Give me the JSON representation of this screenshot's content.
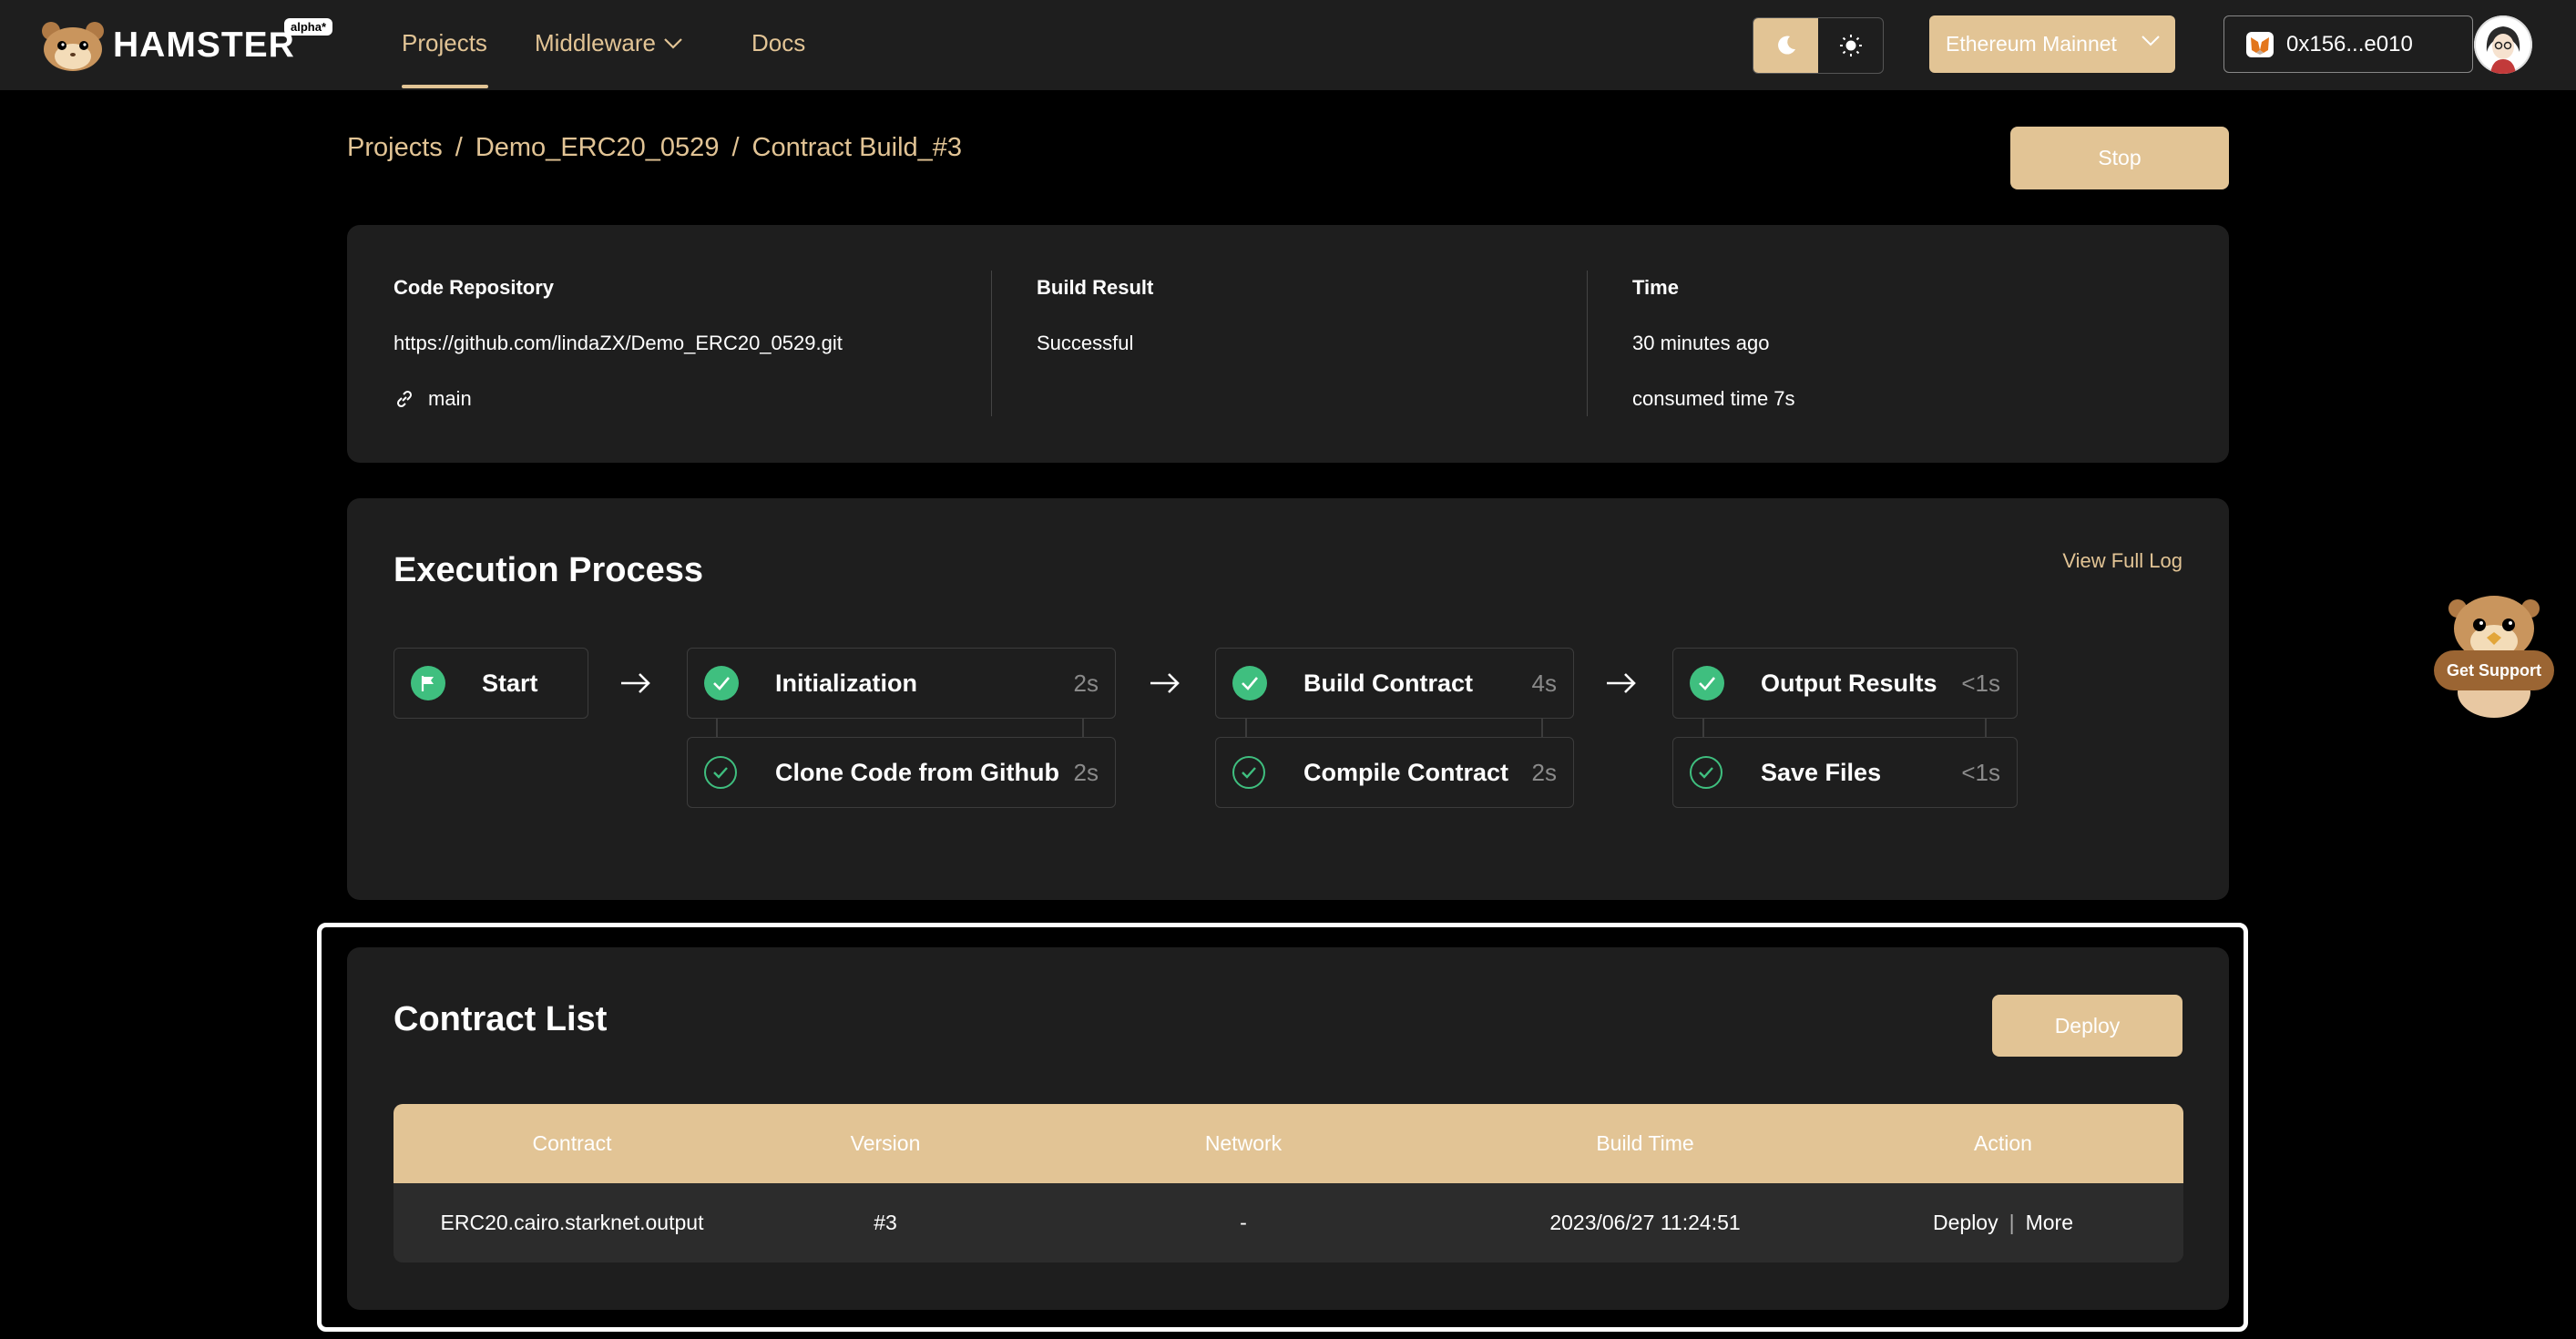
{
  "app": {
    "brand": "HAMSTER",
    "badge": "alpha*"
  },
  "nav": {
    "projects": "Projects",
    "middleware": "Middleware",
    "docs": "Docs"
  },
  "header": {
    "network": "Ethereum Mainnet",
    "wallet": "0x156...e010"
  },
  "breadcrumb": [
    "Projects",
    "Demo_ERC20_0529",
    "Contract Build_#3"
  ],
  "breadcrumb_sep": "/",
  "actions": {
    "stop": "Stop"
  },
  "info": {
    "repo_label": "Code Repository",
    "repo_url": "https://github.com/lindaZX/Demo_ERC20_0529.git",
    "branch": "main",
    "result_label": "Build Result",
    "result_value": "Successful",
    "time_label": "Time",
    "time_ago": "30 minutes ago",
    "consumed": "consumed time 7s"
  },
  "execution": {
    "title": "Execution Process",
    "view_log": "View Full Log",
    "start": "Start",
    "stages": [
      {
        "name": "Initialization",
        "dur": "2s",
        "sub_name": "Clone Code from Github",
        "sub_dur": "2s"
      },
      {
        "name": "Build Contract",
        "dur": "4s",
        "sub_name": "Compile Contract",
        "sub_dur": "2s"
      },
      {
        "name": "Output Results",
        "dur": "<1s",
        "sub_name": "Save Files",
        "sub_dur": "<1s"
      }
    ]
  },
  "contracts": {
    "title": "Contract List",
    "deploy_button": "Deploy",
    "columns": [
      "Contract",
      "Version",
      "Network",
      "Build Time",
      "Action"
    ],
    "rows": [
      {
        "contract": "ERC20.cairo.starknet.output",
        "version": "#3",
        "network": "-",
        "build_time": "2023/06/27 11:24:51",
        "action_deploy": "Deploy",
        "action_sep": "|",
        "action_more": "More"
      }
    ]
  },
  "support": {
    "label": "Get Support"
  },
  "colors": {
    "accent": "#e2c495",
    "success": "#3fbf7f",
    "panel": "#1e1e1e",
    "page": "#000000"
  }
}
